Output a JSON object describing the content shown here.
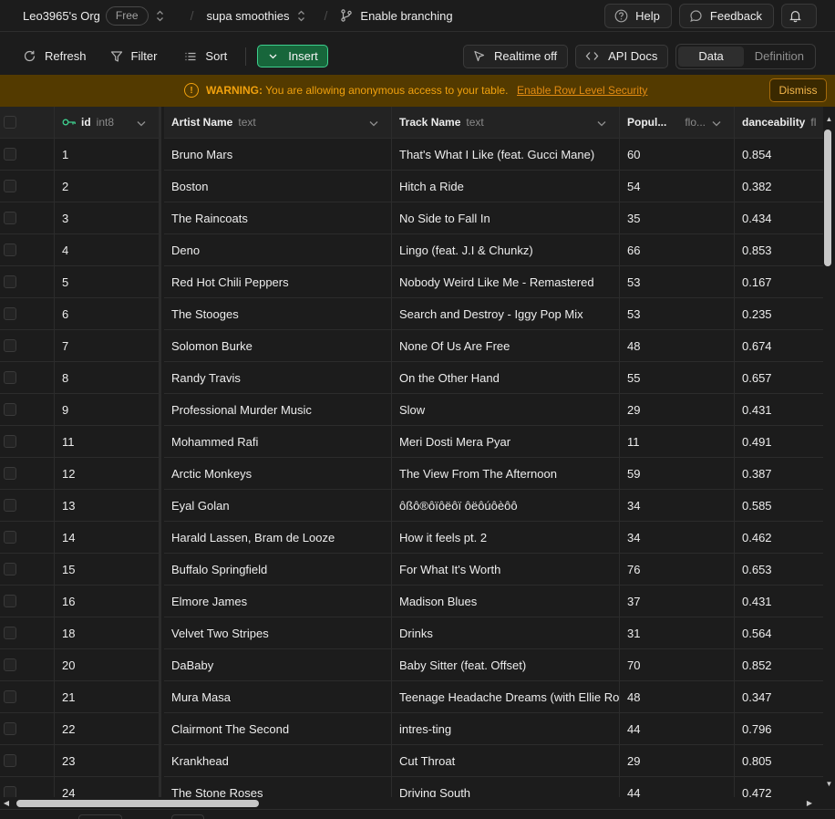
{
  "topbar": {
    "org": "Leo3965's Org",
    "plan": "Free",
    "project": "supa smoothies",
    "branch": "Enable branching",
    "help": "Help",
    "feedback": "Feedback"
  },
  "toolbar": {
    "refresh": "Refresh",
    "filter": "Filter",
    "sort": "Sort",
    "insert": "Insert",
    "realtime": "Realtime off",
    "api_docs": "API Docs",
    "tab_data": "Data",
    "tab_definition": "Definition"
  },
  "warning": {
    "label": "WARNING:",
    "message": "You are allowing anonymous access to your table.",
    "link": "Enable Row Level Security",
    "dismiss": "Dismiss"
  },
  "columns": [
    {
      "name": "id",
      "type": "int8"
    },
    {
      "name": "Artist Name",
      "type": "text"
    },
    {
      "name": "Track Name",
      "type": "text"
    },
    {
      "name": "Popul...",
      "type": "flo..."
    },
    {
      "name": "danceability",
      "type": "fl"
    }
  ],
  "rows": [
    [
      "1",
      "Bruno Mars",
      "That's What I Like (feat. Gucci Mane)",
      "60",
      "0.854"
    ],
    [
      "2",
      "Boston",
      "Hitch a Ride",
      "54",
      "0.382"
    ],
    [
      "3",
      "The Raincoats",
      "No Side to Fall In",
      "35",
      "0.434"
    ],
    [
      "4",
      "Deno",
      "Lingo (feat. J.I & Chunkz)",
      "66",
      "0.853"
    ],
    [
      "5",
      "Red Hot Chili Peppers",
      "Nobody Weird Like Me - Remastered",
      "53",
      "0.167"
    ],
    [
      "6",
      "The Stooges",
      "Search and Destroy - Iggy Pop Mix",
      "53",
      "0.235"
    ],
    [
      "7",
      "Solomon Burke",
      "None Of Us Are Free",
      "48",
      "0.674"
    ],
    [
      "8",
      "Randy Travis",
      "On the Other Hand",
      "55",
      "0.657"
    ],
    [
      "9",
      "Professional Murder Music",
      "Slow",
      "29",
      "0.431"
    ],
    [
      "11",
      "Mohammed Rafi",
      "Meri Dosti Mera Pyar",
      "11",
      "0.491"
    ],
    [
      "12",
      "Arctic Monkeys",
      "The View From The Afternoon",
      "59",
      "0.387"
    ],
    [
      "13",
      "Eyal Golan",
      "ôßô®ôïôëôï ôëôúôèôô",
      "34",
      "0.585"
    ],
    [
      "14",
      "Harald Lassen, Bram de Looze",
      "How it feels pt. 2",
      "34",
      "0.462"
    ],
    [
      "15",
      "Buffalo Springfield",
      "For What It's Worth",
      "76",
      "0.653"
    ],
    [
      "16",
      "Elmore James",
      "Madison Blues",
      "37",
      "0.431"
    ],
    [
      "18",
      "Velvet Two Stripes",
      "Drinks",
      "31",
      "0.564"
    ],
    [
      "20",
      "DaBaby",
      "Baby Sitter (feat. Offset)",
      "70",
      "0.852"
    ],
    [
      "21",
      "Mura Masa",
      "Teenage Headache Dreams (with Ellie Rowsell)",
      "48",
      "0.347"
    ],
    [
      "22",
      "Clairmont The Second",
      "intres-ting",
      "44",
      "0.796"
    ],
    [
      "23",
      "Krankhead",
      "Cut Throat",
      "29",
      "0.805"
    ],
    [
      "24",
      "The Stone Roses",
      "Driving South",
      "44",
      "0.472"
    ]
  ]
}
